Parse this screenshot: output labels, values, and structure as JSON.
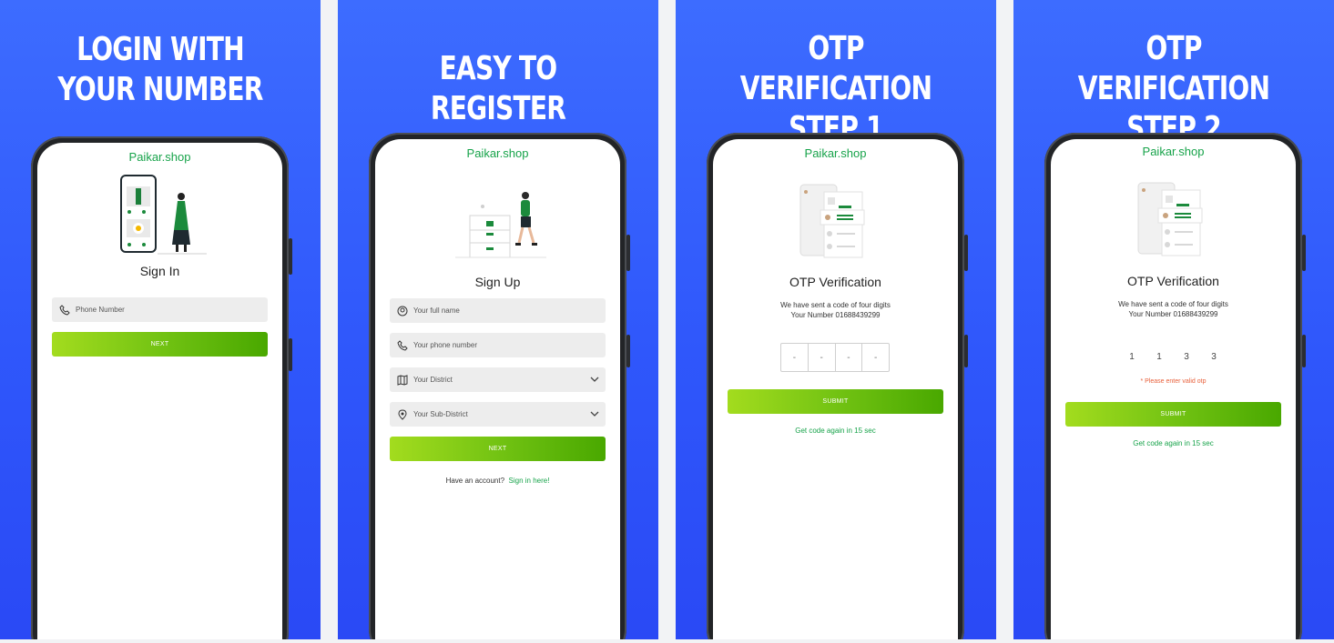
{
  "panels": [
    {
      "heading": [
        "LOGIN WITH",
        "YOUR NUMBER"
      ],
      "brand": "Paikar.shop",
      "title": "Sign In",
      "phone_placeholder": "Phone Number",
      "button": "NEXT"
    },
    {
      "heading": [
        "EASY TO REGISTER"
      ],
      "brand": "Paikar.shop",
      "title": "Sign Up",
      "fields": [
        "Your full name",
        "Your phone number",
        "Your District",
        "Your Sub-District"
      ],
      "button": "NEXT",
      "have_account": "Have an account?",
      "sign_in_link": "Sign in here!"
    },
    {
      "heading": [
        "OTP VERIFICATION",
        "STEP 1"
      ],
      "brand": "Paikar.shop",
      "title": "OTP Verification",
      "sent_line": "We have sent a code of four digits",
      "number_line": "Your Number  01688439299",
      "otp": [
        "-",
        "-",
        "-",
        "-"
      ],
      "button": "SUBMIT",
      "resend": "Get code again in 15 sec"
    },
    {
      "heading": [
        "OTP VERIFICATION",
        "STEP 2"
      ],
      "brand": "Paikar.shop",
      "title": "OTP Verification",
      "sent_line": "We have sent a code of four digits",
      "number_line": "Your Number  01688439299",
      "otp": [
        "1",
        "1",
        "3",
        "3"
      ],
      "error": "* Please enter valid otp",
      "button": "SUBMIT",
      "resend": "Get code again in 15 sec"
    }
  ],
  "colors": {
    "panel_blue": "#2f57fb",
    "brand_green": "#17a34a",
    "button_gradient_start": "#a3dc1e",
    "button_gradient_end": "#49a800",
    "error": "#e8613c"
  }
}
